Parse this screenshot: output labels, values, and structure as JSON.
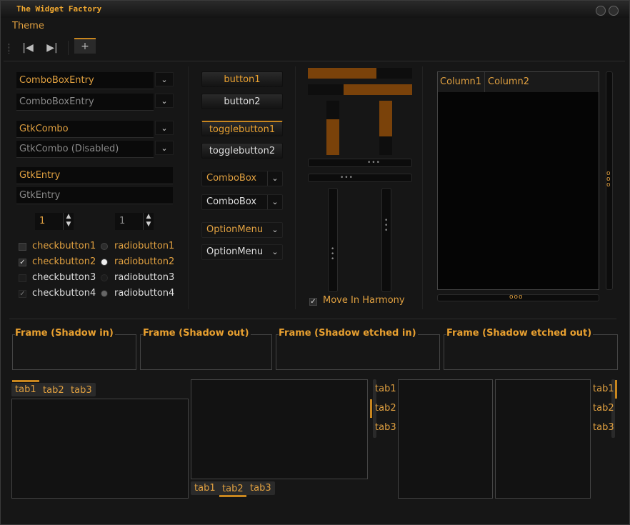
{
  "window": {
    "title": "The Widget Factory"
  },
  "menubar": {
    "theme": "Theme"
  },
  "left": {
    "combo_entry_1": "ComboBoxEntry",
    "combo_entry_2": "ComboBoxEntry",
    "gtk_combo_1": "GtkCombo",
    "gtk_combo_2": "GtkCombo (Disabled)",
    "gtk_entry_1": "GtkEntry",
    "gtk_entry_2": "GtkEntry",
    "spin_1": "1",
    "spin_2": "1",
    "checkbuttons": [
      "checkbutton1",
      "checkbutton2",
      "checkbutton3",
      "checkbutton4"
    ],
    "radiobuttons": [
      "radiobutton1",
      "radiobutton2",
      "radiobutton3",
      "radiobutton4"
    ]
  },
  "middle": {
    "button1": "button1",
    "button2": "button2",
    "togglebutton1": "togglebutton1",
    "togglebutton2": "togglebutton2",
    "combobox1": "ComboBox",
    "combobox2": "ComboBox",
    "optionmenu1": "OptionMenu",
    "optionmenu2": "OptionMenu"
  },
  "progress": {
    "h1": 0.66,
    "h2": 0.66,
    "v1": 0.66,
    "v2": 0.66
  },
  "move_in_harmony": "Move In Harmony",
  "tree": {
    "columns": [
      "Column1",
      "Column2"
    ]
  },
  "frames": [
    "Frame (Shadow in)",
    "Frame (Shadow out)",
    "Frame (Shadow etched in)",
    "Frame (Shadow etched out)"
  ],
  "notebooks": {
    "top": [
      "tab1",
      "tab2",
      "tab3"
    ],
    "bottom": [
      "tab1",
      "tab2",
      "tab3"
    ],
    "left": [
      "tab1",
      "tab2",
      "tab3"
    ],
    "right": [
      "tab1",
      "tab2",
      "tab3"
    ]
  },
  "colors": {
    "accent": "#e0a040",
    "progress": "#7a420a",
    "bg": "#161616"
  }
}
